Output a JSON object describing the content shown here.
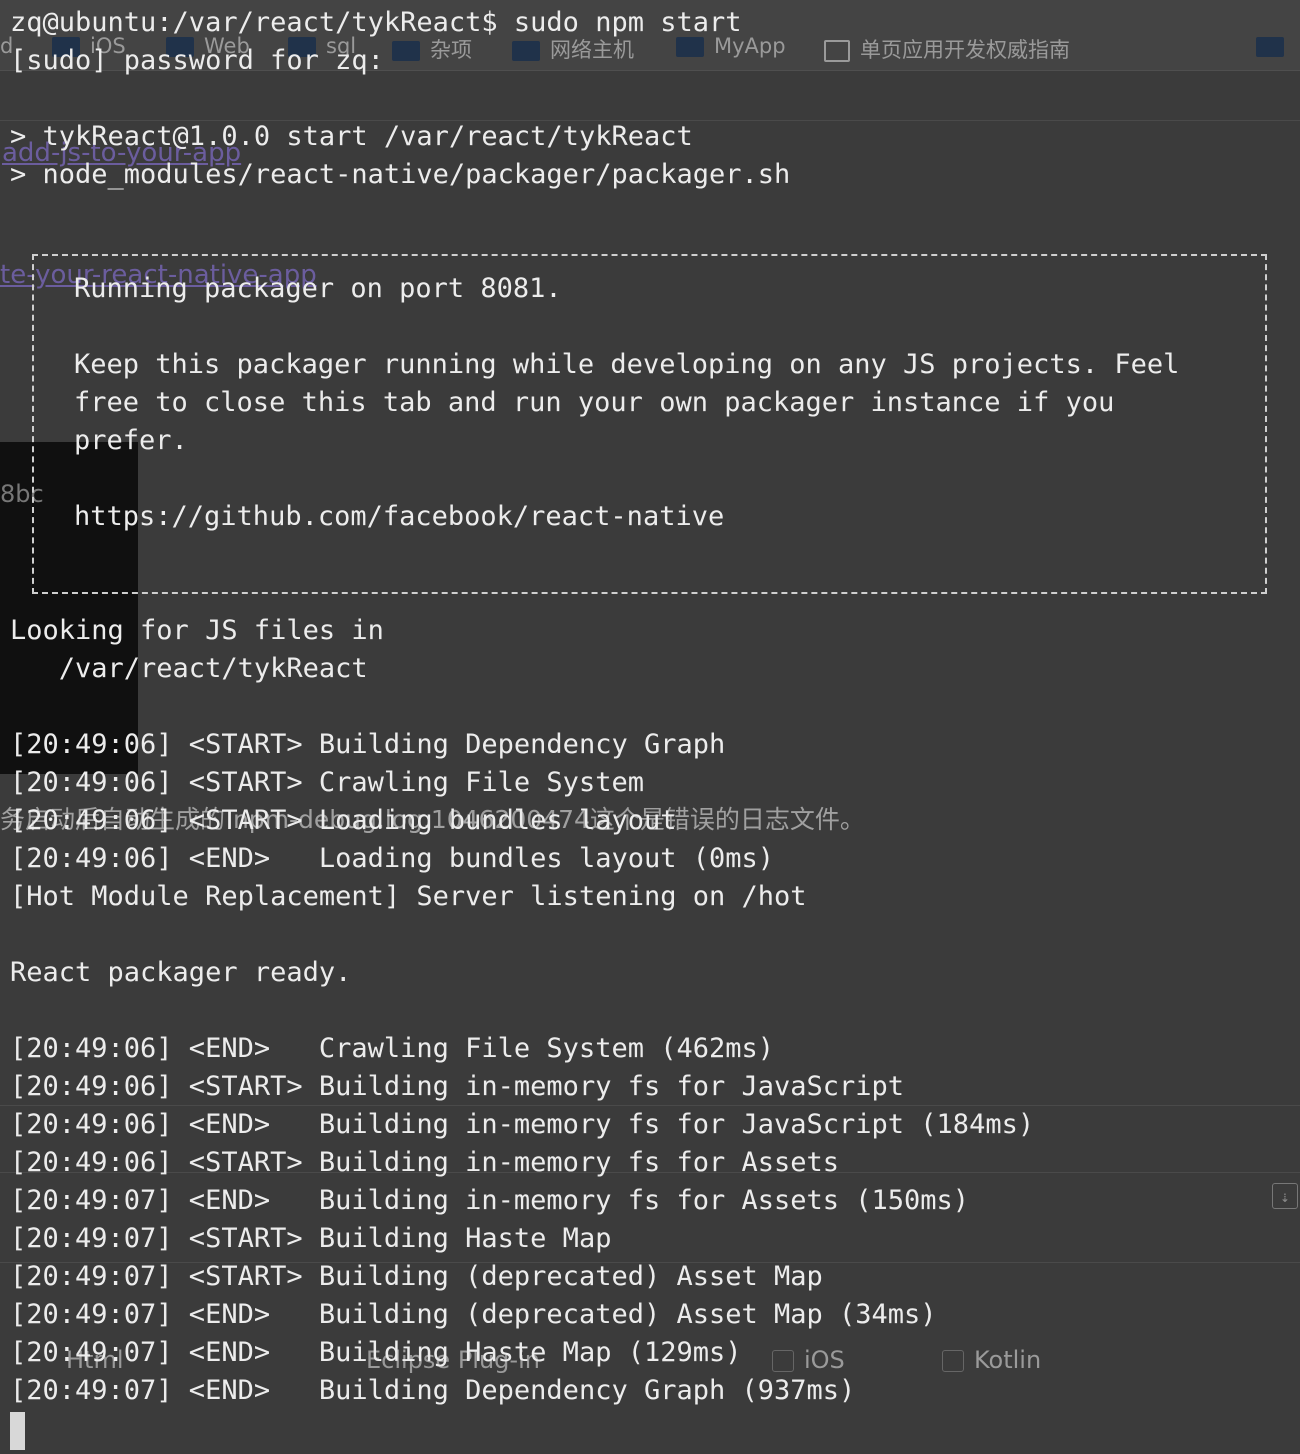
{
  "background_ghost": {
    "bookmarks": [
      {
        "label": "d",
        "icon": "folder-icon"
      },
      {
        "label": "iOS",
        "icon": "folder-icon"
      },
      {
        "label": "Web",
        "icon": "folder-icon"
      },
      {
        "label": "sql",
        "icon": "folder-icon"
      },
      {
        "label": "杂项",
        "icon": "folder-icon"
      },
      {
        "label": "网络主机",
        "icon": "folder-icon"
      },
      {
        "label": "MyApp",
        "icon": "folder-icon"
      },
      {
        "label": "单页应用开发权威指南",
        "icon": "book-icon"
      }
    ],
    "link_1": "add-js-to-your-app",
    "link_2": "te-your-react-native-app",
    "side_text": "8bc",
    "cjk_text": "务启动后自动生成的 npm-debug.log.1046200474这个是错误的日志文件。",
    "checkboxes": [
      {
        "label": "Html"
      },
      {
        "label": "Eclipse Plug-in"
      },
      {
        "label": "iOS"
      },
      {
        "label": "Kotlin"
      }
    ]
  },
  "terminal": {
    "command_line": "zq@ubuntu:/var/react/tykReact$ sudo npm start",
    "sudo_prompt": "[sudo] password for zq:",
    "npm_lines": [
      "> tykReact@1.0.0 start /var/react/tykReact",
      "> node_modules/react-native/packager/packager.sh"
    ],
    "banner": {
      "line1": "Running packager on port 8081.",
      "line2": "Keep this packager running while developing on any JS projects. Feel",
      "line3": "free to close this tab and run your own packager instance if you",
      "line4": "prefer.",
      "url": "https://github.com/facebook/react-native"
    },
    "looking_1": "Looking for JS files in",
    "looking_2": "   /var/react/tykReact",
    "log_block_1": [
      "[20:49:06] <START> Building Dependency Graph",
      "[20:49:06] <START> Crawling File System",
      "[20:49:06] <START> Loading bundles layout",
      "[20:49:06] <END>   Loading bundles layout (0ms)",
      "[Hot Module Replacement] Server listening on /hot"
    ],
    "ready": "React packager ready.",
    "log_block_2": [
      "[20:49:06] <END>   Crawling File System (462ms)",
      "[20:49:06] <START> Building in-memory fs for JavaScript",
      "[20:49:06] <END>   Building in-memory fs for JavaScript (184ms)",
      "[20:49:06] <START> Building in-memory fs for Assets",
      "[20:49:07] <END>   Building in-memory fs for Assets (150ms)",
      "[20:49:07] <START> Building Haste Map",
      "[20:49:07] <START> Building (deprecated) Asset Map",
      "[20:49:07] <END>   Building (deprecated) Asset Map (34ms)",
      "[20:49:07] <END>   Building Haste Map (129ms)",
      "[20:49:07] <END>   Building Dependency Graph (937ms)"
    ]
  }
}
